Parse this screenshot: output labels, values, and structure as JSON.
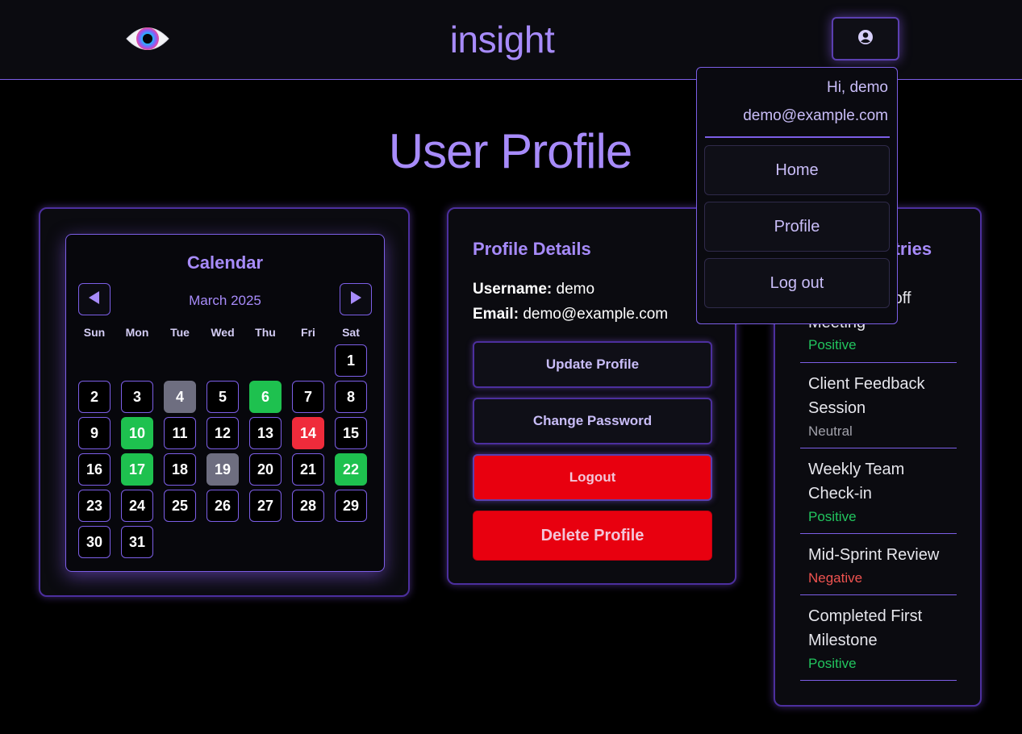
{
  "header": {
    "app_title": "insight",
    "logo_icon": "eye-icon",
    "user_icon": "user-circle-icon"
  },
  "page_title": "User Profile",
  "calendar": {
    "title": "Calendar",
    "month_label": "March 2025",
    "prev_icon": "triangle-left-icon",
    "next_icon": "triangle-right-icon",
    "weekdays": [
      "Sun",
      "Mon",
      "Tue",
      "Wed",
      "Thu",
      "Fri",
      "Sat"
    ],
    "first_weekday_index": 6,
    "days_in_month": 31,
    "marked_days": {
      "4": "neutral",
      "6": "positive",
      "10": "positive",
      "14": "negative",
      "17": "positive",
      "19": "neutral",
      "22": "positive"
    },
    "colors": {
      "positive": "#1ec14f",
      "negative": "#ef2b3b",
      "neutral": "#6e6e80"
    }
  },
  "profile": {
    "title": "Profile Details",
    "username_label": "Username:",
    "username": "demo",
    "email_label": "Email:",
    "email": "demo@example.com",
    "update_label": "Update Profile",
    "change_password_label": "Change Password",
    "logout_label": "Logout",
    "delete_label": "Delete Profile"
  },
  "entries": {
    "title": "Recent Entries",
    "items": [
      {
        "title": "Project Kickoff Meeting",
        "sentiment": "Positive"
      },
      {
        "title": "Client Feedback Session",
        "sentiment": "Neutral"
      },
      {
        "title": "Weekly Team Check-in",
        "sentiment": "Positive"
      },
      {
        "title": "Mid-Sprint Review",
        "sentiment": "Negative"
      },
      {
        "title": "Completed First Milestone",
        "sentiment": "Positive"
      }
    ]
  },
  "dropdown": {
    "greeting": "Hi, demo",
    "email": "demo@example.com",
    "items": [
      "Home",
      "Profile",
      "Log out"
    ]
  },
  "accent_color": "#a78bfa"
}
